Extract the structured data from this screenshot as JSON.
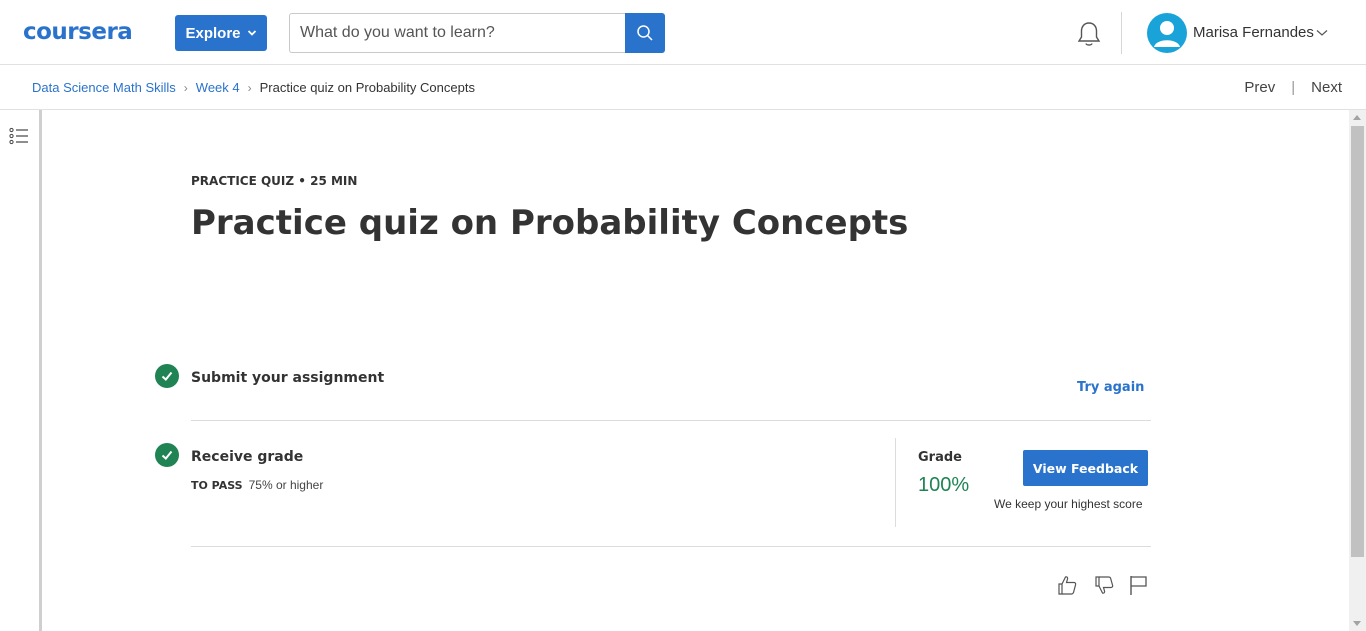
{
  "header": {
    "logo": "coursera",
    "explore_label": "Explore",
    "search_placeholder": "What do you want to learn?",
    "user_name": "Marisa Fernandes"
  },
  "breadcrumb": {
    "items": [
      "Data Science Math Skills",
      "Week 4"
    ],
    "current": "Practice quiz on Probability Concepts"
  },
  "nav": {
    "prev": "Prev",
    "next": "Next"
  },
  "quiz": {
    "meta": "PRACTICE QUIZ • 25 MIN",
    "title": "Practice quiz on Probability Concepts",
    "step1_title": "Submit your assignment",
    "try_again": "Try again",
    "step2_title": "Receive grade",
    "to_pass_label": "TO PASS",
    "to_pass_value": "75% or higher",
    "grade_label": "Grade",
    "grade_value": "100%",
    "view_feedback": "View Feedback",
    "highest_note": "We keep your highest score"
  },
  "colors": {
    "brand": "#2a73cc",
    "success": "#1f8354"
  }
}
